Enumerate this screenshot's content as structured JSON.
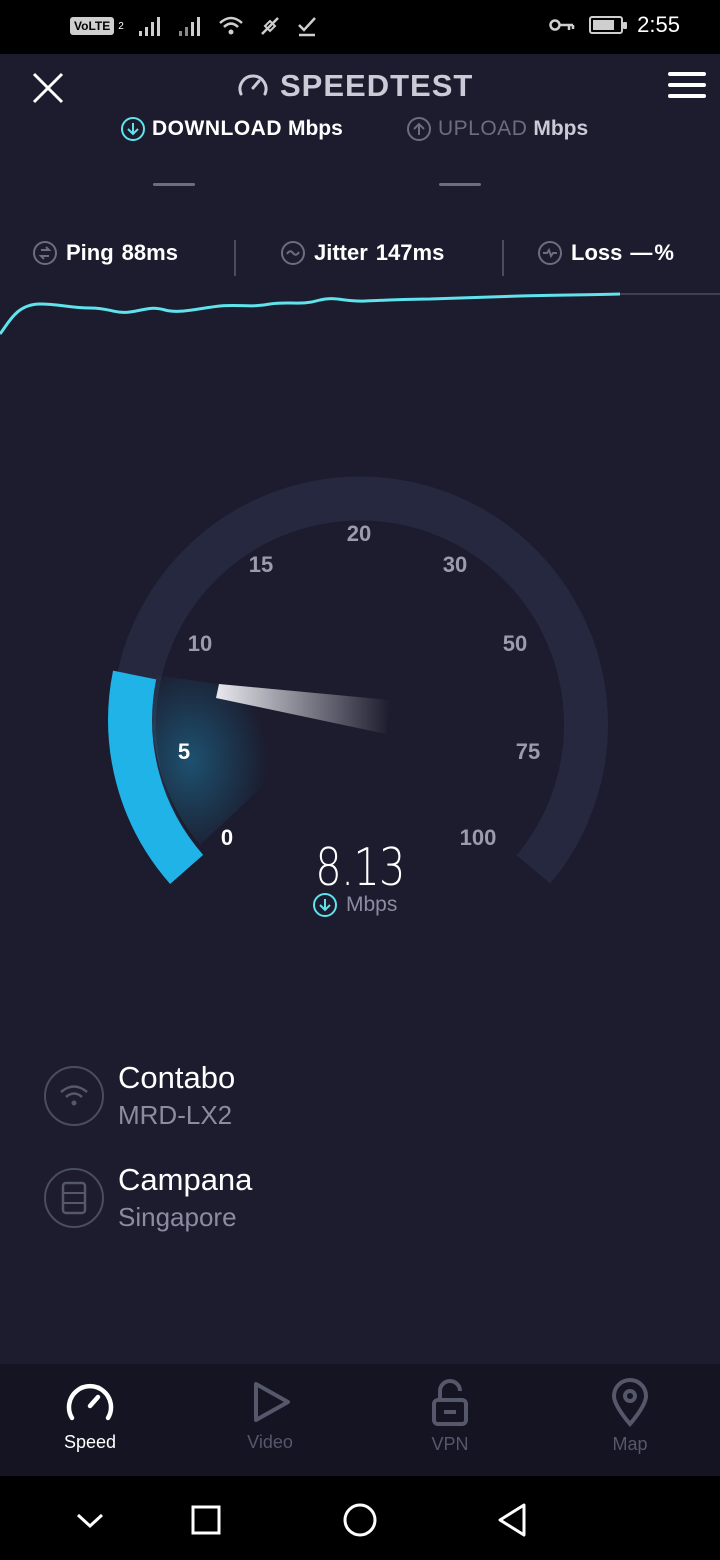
{
  "status_bar": {
    "volte": "VoLTE",
    "sim_index": "2",
    "time": "2:55",
    "battery_level": 0.8
  },
  "header": {
    "title": "SPEEDTEST"
  },
  "download": {
    "label": "DOWNLOAD",
    "unit": "Mbps",
    "value": "—"
  },
  "upload": {
    "label": "UPLOAD",
    "unit": "Mbps",
    "value": "—"
  },
  "stats": {
    "ping": {
      "label": "Ping",
      "value": "88ms"
    },
    "jitter": {
      "label": "Jitter",
      "value": "147ms"
    },
    "loss": {
      "label": "Loss",
      "value": "—",
      "unit": "%"
    }
  },
  "gauge": {
    "ticks": [
      "0",
      "5",
      "10",
      "15",
      "20",
      "30",
      "50",
      "75",
      "100"
    ],
    "current_speed": "8.13",
    "unit": "Mbps"
  },
  "provider": {
    "name": "Contabo",
    "device": "MRD-LX2"
  },
  "server": {
    "name": "Campana",
    "location": "Singapore"
  },
  "tabs": [
    {
      "label": "Speed",
      "active": true
    },
    {
      "label": "Video",
      "active": false
    },
    {
      "label": "VPN",
      "active": false
    },
    {
      "label": "Map",
      "active": false
    }
  ],
  "colors": {
    "background": "#1c1c2e",
    "accent": "#1fb3e8",
    "graph_line": "#5fe3ec",
    "muted": "#8a8ca0"
  }
}
